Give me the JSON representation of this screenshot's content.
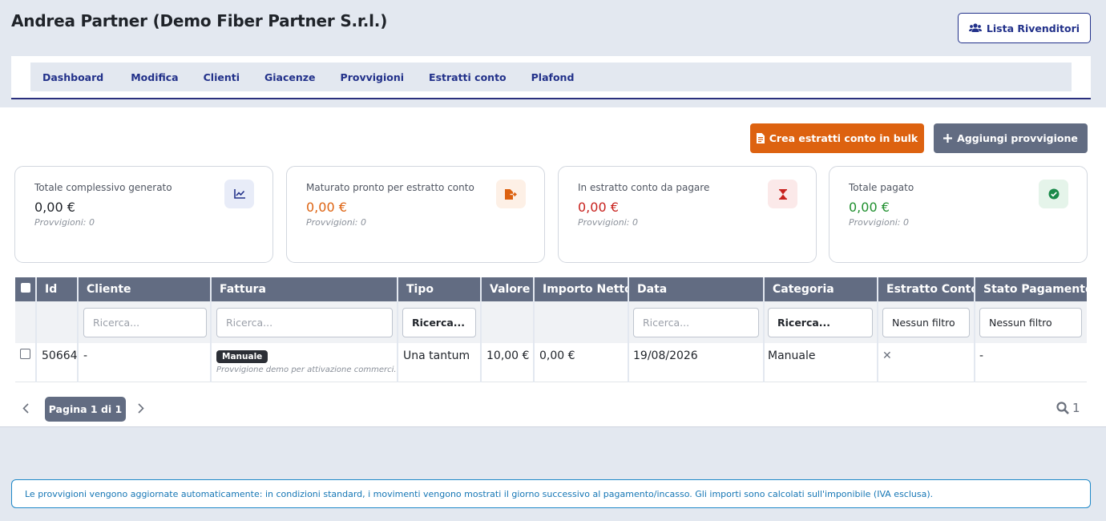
{
  "header": {
    "title": "Andrea Partner (Demo Fiber Partner S.r.l.)",
    "resellers_button": "Lista Rivenditori"
  },
  "nav": [
    "Dashboard",
    "Modifica",
    "Clienti",
    "Giacenze",
    "Provvigioni",
    "Estratti conto",
    "Plafond"
  ],
  "actions": {
    "bulk_label": "Crea estratti conto in bulk",
    "add_label": "Aggiungi provvigione",
    "bulk_color": "#dd6210",
    "add_color": "#626c82"
  },
  "cards": [
    {
      "label": "Totale complessivo generato",
      "amount": "0,00 €",
      "sub": "Provvigioni: 0",
      "color": "#1f2329",
      "icon": "chart-line-icon"
    },
    {
      "label": "Maturato pronto per estratto conto",
      "amount": "0,00 €",
      "sub": "Provvigioni: 0",
      "color": "#dd6210",
      "icon": "file-export-icon"
    },
    {
      "label": "In estratto conto da pagare",
      "amount": "0,00 €",
      "sub": "Provvigioni: 0",
      "color": "#c8221e",
      "icon": "hourglass-icon"
    },
    {
      "label": "Totale pagato",
      "amount": "0,00 €",
      "sub": "Provvigioni: 0",
      "color": "#1f8f2e",
      "icon": "check-circle-icon"
    }
  ],
  "table": {
    "columns": [
      "Id",
      "Cliente",
      "Fattura",
      "Tipo",
      "Valore",
      "Importo Netto",
      "Data",
      "Categoria",
      "Estratto Conto",
      "Stato Pagamento"
    ],
    "filters": {
      "cliente": "Ricerca...",
      "fattura": "Ricerca...",
      "tipo": "Ricerca...",
      "data": "Ricerca...",
      "categoria": "Ricerca...",
      "estratto": "Nessun filtro",
      "stato": "Nessun filtro"
    },
    "rows": [
      {
        "id": "50664",
        "cliente": "-",
        "fattura_badge": "Manuale",
        "fattura_desc": "Provvigione demo per attivazione commerci...",
        "tipo": "Una tantum",
        "valore": "10,00 €",
        "importo_netto": "0,00 €",
        "data": "19/08/2026",
        "categoria": "Manuale",
        "estratto_conto": "✕",
        "stato_pagamento": "-"
      }
    ]
  },
  "pagination": {
    "label": "Pagina 1 di 1",
    "count": "1"
  },
  "info_text": "Le provvigioni vengono aggiornate automaticamente: in condizioni standard, i movimenti vengono mostrati il giorno successivo al pagamento/incasso. Gli importi sono calcolati sull'imponibile (IVA esclusa)."
}
